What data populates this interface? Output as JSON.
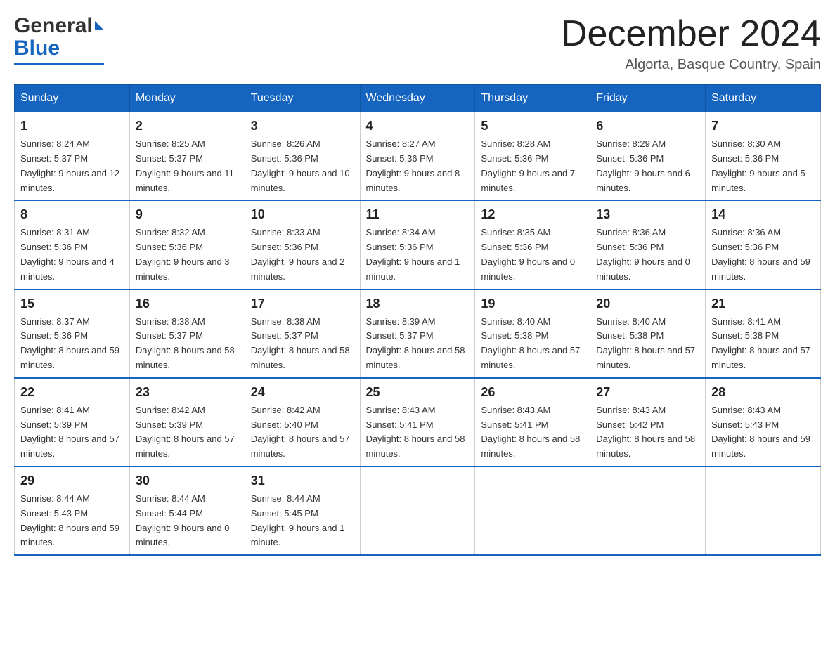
{
  "logo": {
    "general": "General",
    "blue": "Blue"
  },
  "title": "December 2024",
  "subtitle": "Algorta, Basque Country, Spain",
  "days_of_week": [
    "Sunday",
    "Monday",
    "Tuesday",
    "Wednesday",
    "Thursday",
    "Friday",
    "Saturday"
  ],
  "weeks": [
    [
      {
        "day": "1",
        "sunrise": "8:24 AM",
        "sunset": "5:37 PM",
        "daylight": "9 hours and 12 minutes."
      },
      {
        "day": "2",
        "sunrise": "8:25 AM",
        "sunset": "5:37 PM",
        "daylight": "9 hours and 11 minutes."
      },
      {
        "day": "3",
        "sunrise": "8:26 AM",
        "sunset": "5:36 PM",
        "daylight": "9 hours and 10 minutes."
      },
      {
        "day": "4",
        "sunrise": "8:27 AM",
        "sunset": "5:36 PM",
        "daylight": "9 hours and 8 minutes."
      },
      {
        "day": "5",
        "sunrise": "8:28 AM",
        "sunset": "5:36 PM",
        "daylight": "9 hours and 7 minutes."
      },
      {
        "day": "6",
        "sunrise": "8:29 AM",
        "sunset": "5:36 PM",
        "daylight": "9 hours and 6 minutes."
      },
      {
        "day": "7",
        "sunrise": "8:30 AM",
        "sunset": "5:36 PM",
        "daylight": "9 hours and 5 minutes."
      }
    ],
    [
      {
        "day": "8",
        "sunrise": "8:31 AM",
        "sunset": "5:36 PM",
        "daylight": "9 hours and 4 minutes."
      },
      {
        "day": "9",
        "sunrise": "8:32 AM",
        "sunset": "5:36 PM",
        "daylight": "9 hours and 3 minutes."
      },
      {
        "day": "10",
        "sunrise": "8:33 AM",
        "sunset": "5:36 PM",
        "daylight": "9 hours and 2 minutes."
      },
      {
        "day": "11",
        "sunrise": "8:34 AM",
        "sunset": "5:36 PM",
        "daylight": "9 hours and 1 minute."
      },
      {
        "day": "12",
        "sunrise": "8:35 AM",
        "sunset": "5:36 PM",
        "daylight": "9 hours and 0 minutes."
      },
      {
        "day": "13",
        "sunrise": "8:36 AM",
        "sunset": "5:36 PM",
        "daylight": "9 hours and 0 minutes."
      },
      {
        "day": "14",
        "sunrise": "8:36 AM",
        "sunset": "5:36 PM",
        "daylight": "8 hours and 59 minutes."
      }
    ],
    [
      {
        "day": "15",
        "sunrise": "8:37 AM",
        "sunset": "5:36 PM",
        "daylight": "8 hours and 59 minutes."
      },
      {
        "day": "16",
        "sunrise": "8:38 AM",
        "sunset": "5:37 PM",
        "daylight": "8 hours and 58 minutes."
      },
      {
        "day": "17",
        "sunrise": "8:38 AM",
        "sunset": "5:37 PM",
        "daylight": "8 hours and 58 minutes."
      },
      {
        "day": "18",
        "sunrise": "8:39 AM",
        "sunset": "5:37 PM",
        "daylight": "8 hours and 58 minutes."
      },
      {
        "day": "19",
        "sunrise": "8:40 AM",
        "sunset": "5:38 PM",
        "daylight": "8 hours and 57 minutes."
      },
      {
        "day": "20",
        "sunrise": "8:40 AM",
        "sunset": "5:38 PM",
        "daylight": "8 hours and 57 minutes."
      },
      {
        "day": "21",
        "sunrise": "8:41 AM",
        "sunset": "5:38 PM",
        "daylight": "8 hours and 57 minutes."
      }
    ],
    [
      {
        "day": "22",
        "sunrise": "8:41 AM",
        "sunset": "5:39 PM",
        "daylight": "8 hours and 57 minutes."
      },
      {
        "day": "23",
        "sunrise": "8:42 AM",
        "sunset": "5:39 PM",
        "daylight": "8 hours and 57 minutes."
      },
      {
        "day": "24",
        "sunrise": "8:42 AM",
        "sunset": "5:40 PM",
        "daylight": "8 hours and 57 minutes."
      },
      {
        "day": "25",
        "sunrise": "8:43 AM",
        "sunset": "5:41 PM",
        "daylight": "8 hours and 58 minutes."
      },
      {
        "day": "26",
        "sunrise": "8:43 AM",
        "sunset": "5:41 PM",
        "daylight": "8 hours and 58 minutes."
      },
      {
        "day": "27",
        "sunrise": "8:43 AM",
        "sunset": "5:42 PM",
        "daylight": "8 hours and 58 minutes."
      },
      {
        "day": "28",
        "sunrise": "8:43 AM",
        "sunset": "5:43 PM",
        "daylight": "8 hours and 59 minutes."
      }
    ],
    [
      {
        "day": "29",
        "sunrise": "8:44 AM",
        "sunset": "5:43 PM",
        "daylight": "8 hours and 59 minutes."
      },
      {
        "day": "30",
        "sunrise": "8:44 AM",
        "sunset": "5:44 PM",
        "daylight": "9 hours and 0 minutes."
      },
      {
        "day": "31",
        "sunrise": "8:44 AM",
        "sunset": "5:45 PM",
        "daylight": "9 hours and 1 minute."
      },
      null,
      null,
      null,
      null
    ]
  ]
}
